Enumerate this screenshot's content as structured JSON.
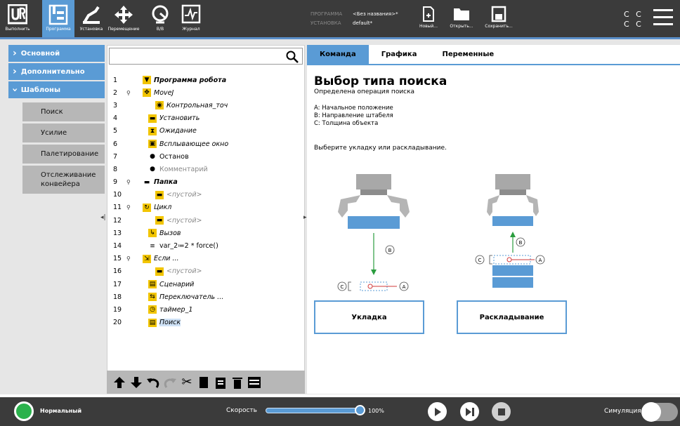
{
  "topbar": {
    "nav": [
      {
        "label": "Выполнить",
        "icon": "ur-logo-icon"
      },
      {
        "label": "Программа",
        "icon": "program-icon",
        "active": true
      },
      {
        "label": "Установка",
        "icon": "installation-icon"
      },
      {
        "label": "Перемещение",
        "icon": "move-icon"
      },
      {
        "label": "В/В",
        "icon": "io-icon"
      },
      {
        "label": "Журнал",
        "icon": "log-icon"
      }
    ],
    "program_key": "ПРОГРАММА",
    "program_val": "<Без названия>*",
    "install_key": "УСТАНОВКА",
    "install_val": "default*",
    "new_label": "Новый...",
    "open_label": "Открыть...",
    "save_label": "Сохранить...",
    "cc_line1": "C C",
    "cc_line2": "C C"
  },
  "sidebar": {
    "sections": [
      {
        "label": "Основной",
        "expanded": false
      },
      {
        "label": "Дополнительно",
        "expanded": false
      },
      {
        "label": "Шаблоны",
        "expanded": true
      }
    ],
    "items": [
      "Поиск",
      "Усилие",
      "Палетирование",
      "Отслеживание конвейера"
    ]
  },
  "tree": {
    "rows": [
      {
        "n": "1",
        "text": "Программа робота",
        "style": "bi",
        "icon": "program-root-icon",
        "indent": 0
      },
      {
        "n": "2",
        "text": "MoveJ",
        "style": "it",
        "icon": "move-icon",
        "indent": 0,
        "pin": true
      },
      {
        "n": "3",
        "text": "Контрольная_точ",
        "style": "it",
        "icon": "waypoint-icon",
        "indent": 2
      },
      {
        "n": "4",
        "text": "Установить",
        "style": "it",
        "icon": "set-icon",
        "indent": 1
      },
      {
        "n": "5",
        "text": "Ожидание",
        "style": "it",
        "icon": "wait-icon",
        "indent": 1
      },
      {
        "n": "6",
        "text": "Всплывающее окно",
        "style": "it",
        "icon": "popup-icon",
        "indent": 1
      },
      {
        "n": "7",
        "text": "Останов",
        "style": "",
        "icon": "halt-icon",
        "indent": 1
      },
      {
        "n": "8",
        "text": "Комментарий",
        "style": "gray",
        "icon": "comment-icon",
        "indent": 1
      },
      {
        "n": "9",
        "text": "Папка",
        "style": "bi",
        "icon": "folder-icon",
        "indent": 0,
        "pin": true
      },
      {
        "n": "10",
        "text": "<пустой>",
        "style": "it gray",
        "icon": "empty-icon",
        "indent": 2
      },
      {
        "n": "11",
        "text": "Цикл",
        "style": "it",
        "icon": "loop-icon",
        "indent": 0,
        "pin": true
      },
      {
        "n": "12",
        "text": "<пустой>",
        "style": "it gray",
        "icon": "empty-icon",
        "indent": 2
      },
      {
        "n": "13",
        "text": "Вызов",
        "style": "it",
        "icon": "call-icon",
        "indent": 1
      },
      {
        "n": "14",
        "text": "var_2≔2 * force()",
        "style": "",
        "icon": "assignment-icon",
        "indent": 1
      },
      {
        "n": "15",
        "text": "Если ...",
        "style": "it",
        "icon": "if-icon",
        "indent": 0,
        "pin": true
      },
      {
        "n": "16",
        "text": "<пустой>",
        "style": "it gray",
        "icon": "empty-icon",
        "indent": 2
      },
      {
        "n": "17",
        "text": "Сценарий",
        "style": "it",
        "icon": "script-icon",
        "indent": 1
      },
      {
        "n": "18",
        "text": "Переключатель ...",
        "style": "it",
        "icon": "switch-icon",
        "indent": 1
      },
      {
        "n": "19",
        "text": "таймер_1",
        "style": "it",
        "icon": "timer-icon",
        "indent": 1
      },
      {
        "n": "20",
        "text": "Поиск",
        "style": "it",
        "icon": "search-node-icon",
        "indent": 1,
        "selected": true
      }
    ]
  },
  "right": {
    "tabs": [
      "Команда",
      "Графика",
      "Переменные"
    ],
    "title": "Выбор типа поиска",
    "subtitle": "Определена операция поиска",
    "legend": [
      "A: Начальное положение",
      "B: Направление штабеля",
      "C: Толщина объекта"
    ],
    "prompt": "Выберите укладку или раскладывание.",
    "stack_button": "Укладка",
    "destack_button": "Раскладывание",
    "marker_a": "A",
    "marker_b": "B",
    "marker_c": "C"
  },
  "bottombar": {
    "status": "Нормальный",
    "speed_label": "Скорость",
    "speed_value": "100%",
    "speed_fraction": 1.0,
    "sim_label": "Симуляция"
  },
  "colors": {
    "accent": "#5a9bd5",
    "dark": "#3b3b3b",
    "status_green": "#2bb24c",
    "arrow_green": "#2a9d3e",
    "marker_red": "#d23a3a"
  }
}
